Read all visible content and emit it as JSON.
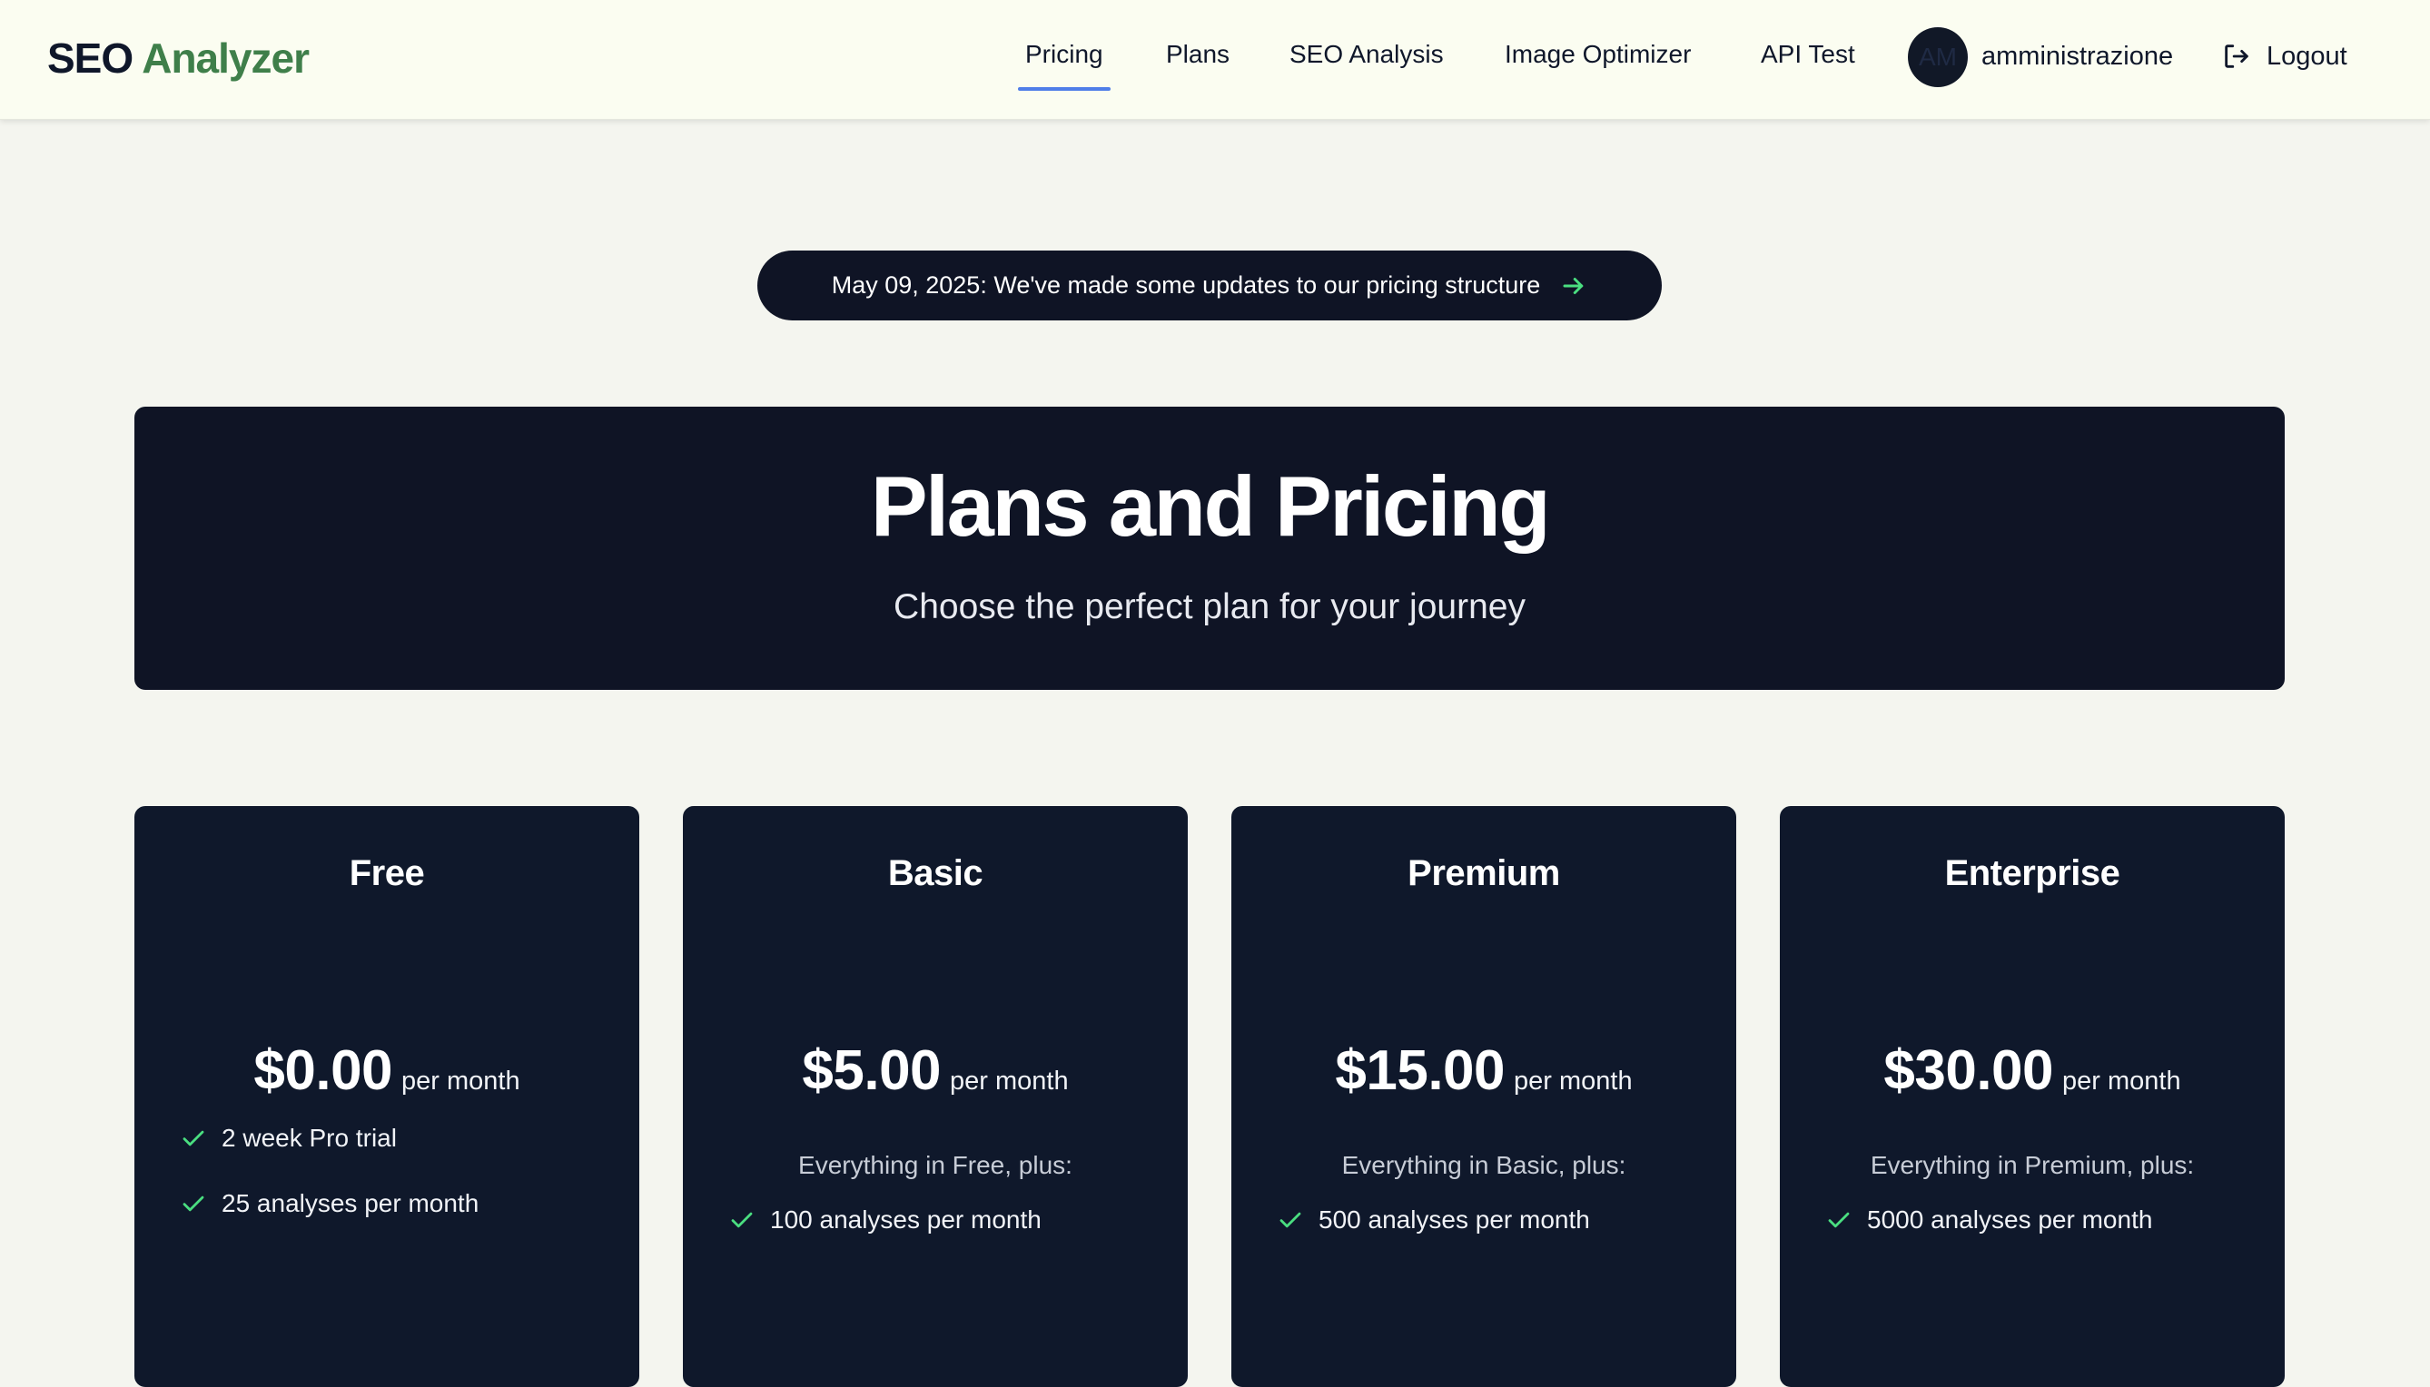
{
  "brand": {
    "part1": "SEO",
    "part2": "Analyzer",
    "accent_color": "#3f7f4a"
  },
  "nav": {
    "links": [
      {
        "label": "Pricing",
        "active": true
      },
      {
        "label": "Plans",
        "active": false
      },
      {
        "label": "SEO Analysis",
        "active": false
      },
      {
        "label": "Image Optimizer",
        "active": false
      },
      {
        "label": "API Test",
        "active": false
      }
    ],
    "active_underline_color": "#4f7ee8",
    "user": {
      "avatar_initials": "AM",
      "username": "amministrazione"
    },
    "logout_label": "Logout",
    "logout_icon": "logout-icon"
  },
  "announcement": {
    "text": "May 09, 2025: We've made some updates to our pricing structure",
    "icon": "arrow-right-icon",
    "icon_color": "#4ade80"
  },
  "hero": {
    "title": "Plans and Pricing",
    "subtitle": "Choose the perfect plan for your journey"
  },
  "plans": [
    {
      "name": "Free",
      "price": "$0.00",
      "period": "per month",
      "intro": "",
      "features": [
        "2 week Pro trial",
        "25 analyses per month"
      ]
    },
    {
      "name": "Basic",
      "price": "$5.00",
      "period": "per month",
      "intro": "Everything in Free, plus:",
      "features": [
        "100 analyses per month"
      ]
    },
    {
      "name": "Premium",
      "price": "$15.00",
      "period": "per month",
      "intro": "Everything in Basic, plus:",
      "features": [
        "500 analyses per month"
      ]
    },
    {
      "name": "Enterprise",
      "price": "$30.00",
      "period": "per month",
      "intro": "Everything in Premium, plus:",
      "features": [
        "5000 analyses per month"
      ]
    }
  ],
  "colors": {
    "page_background": "#f4f5ef",
    "navbar_background": "#fbfdf1",
    "dark_panel": "#0f1425",
    "card_background": "#0f182b",
    "check_color": "#4ade80"
  }
}
